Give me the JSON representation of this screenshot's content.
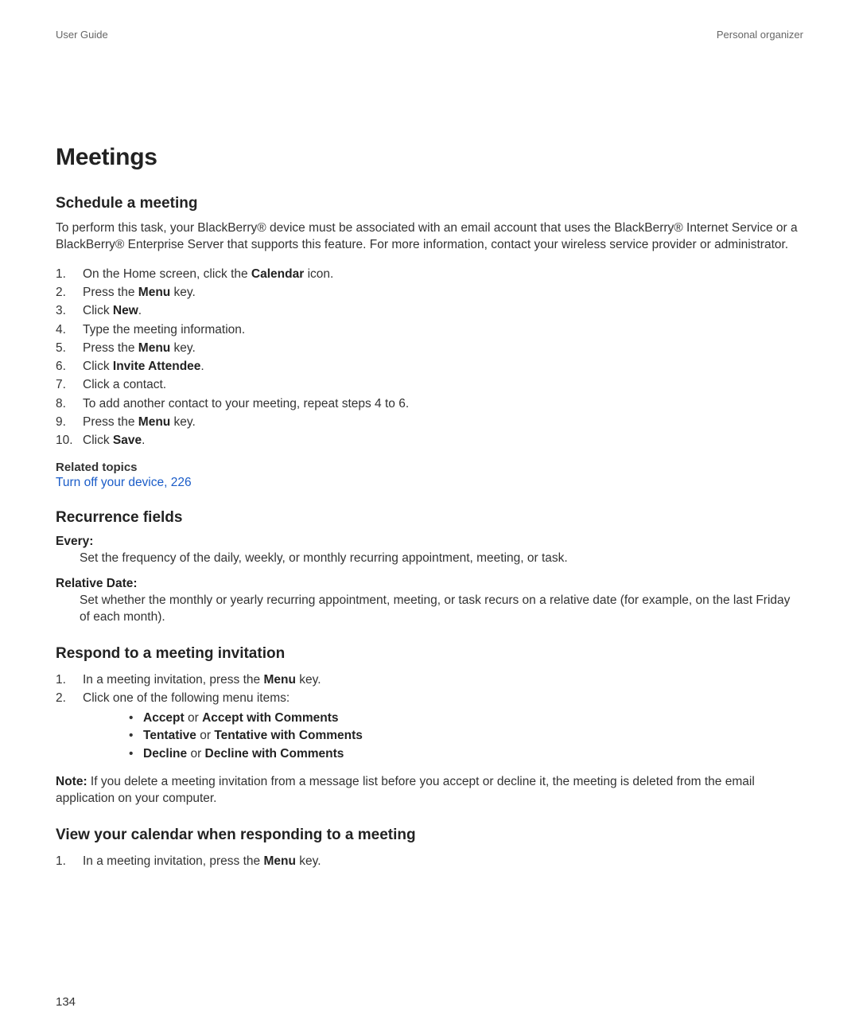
{
  "header": {
    "left": "User Guide",
    "right": "Personal organizer"
  },
  "title": "Meetings",
  "schedule": {
    "heading": "Schedule a meeting",
    "intro": "To perform this task, your BlackBerry® device must be associated with an email account that uses the BlackBerry® Internet Service or a BlackBerry® Enterprise Server that supports this feature. For more information, contact your wireless service provider or administrator.",
    "steps": {
      "s1_pre": "On the Home screen, click the ",
      "s1_bold": "Calendar",
      "s1_post": " icon.",
      "s2_pre": "Press the ",
      "s2_bold": "Menu",
      "s2_post": " key.",
      "s3_pre": "Click ",
      "s3_bold": "New",
      "s3_post": ".",
      "s4": "Type the meeting information.",
      "s5_pre": "Press the ",
      "s5_bold": "Menu",
      "s5_post": " key.",
      "s6_pre": "Click ",
      "s6_bold": "Invite Attendee",
      "s6_post": ".",
      "s7": "Click a contact.",
      "s8": "To add another contact to your meeting, repeat steps 4 to 6.",
      "s9_pre": "Press the ",
      "s9_bold": "Menu",
      "s9_post": " key.",
      "s10_pre": "Click ",
      "s10_bold": "Save",
      "s10_post": "."
    },
    "related_label": "Related topics",
    "related_link": "Turn off your device, 226"
  },
  "recurrence": {
    "heading": "Recurrence fields",
    "every_name": "Every:",
    "every_desc": "Set the frequency of the daily, weekly, or monthly recurring appointment, meeting, or task.",
    "relative_name": "Relative Date:",
    "relative_desc": "Set whether the monthly or yearly recurring appointment, meeting, or task recurs on a relative date (for example, on the last Friday of each month)."
  },
  "respond": {
    "heading": "Respond to a meeting invitation",
    "s1_pre": "In a meeting invitation, press the ",
    "s1_bold": "Menu",
    "s1_post": " key.",
    "s2": "Click one of the following menu items:",
    "b1_a": "Accept",
    "b1_mid": " or ",
    "b1_b": "Accept with Comments",
    "b2_a": "Tentative",
    "b2_mid": " or ",
    "b2_b": "Tentative with Comments",
    "b3_a": "Decline",
    "b3_mid": " or ",
    "b3_b": "Decline with Comments",
    "note_label": "Note:",
    "note_body": "  If you delete a meeting invitation from a message list before you accept or decline it, the meeting is deleted from the email application on your computer."
  },
  "view_cal": {
    "heading": "View your calendar when responding to a meeting",
    "s1_pre": "In a meeting invitation, press the ",
    "s1_bold": "Menu",
    "s1_post": " key."
  },
  "page_number": "134"
}
